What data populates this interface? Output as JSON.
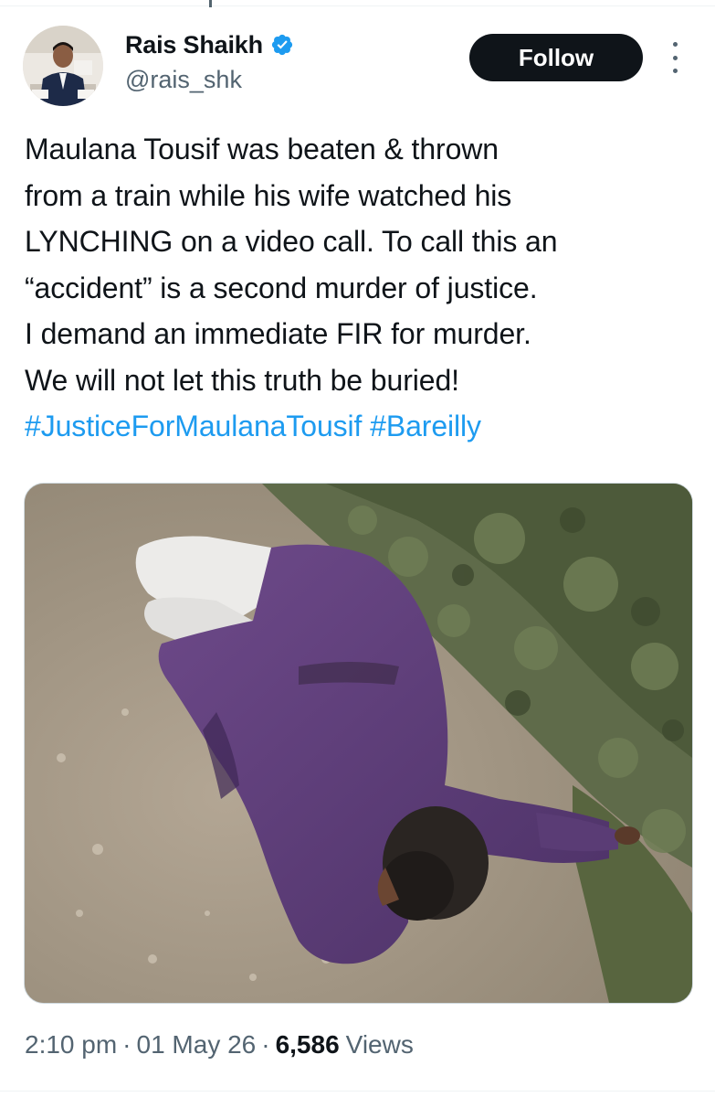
{
  "tweet": {
    "author": {
      "display_name": "Rais Shaikh",
      "handle": "@rais_shk",
      "verified_icon": "verified-badge-icon",
      "avatar_icon": "avatar"
    },
    "follow_label": "Follow",
    "more_icon": "more-options-icon",
    "text_lines": [
      "Maulana Tousif was beaten & thrown",
      "from a train while his wife watched his",
      "LYNCHING on a video call. To call this an",
      "“accident” is a second murder of justice.",
      "I demand an immediate FIR for murder.",
      "We will not let this truth be buried!"
    ],
    "hashtags": [
      "#JusticeForMaulanaTousif",
      "#Bareilly"
    ],
    "timestamp": "2:10 pm",
    "date": "01 May 26",
    "views_count": "6,586",
    "views_label": "Views",
    "separator": "·"
  },
  "colors": {
    "text": "#0f1419",
    "secondary": "#536471",
    "link": "#1d9bf0",
    "verified": "#1d9bf0",
    "button_bg": "#0f1419"
  }
}
